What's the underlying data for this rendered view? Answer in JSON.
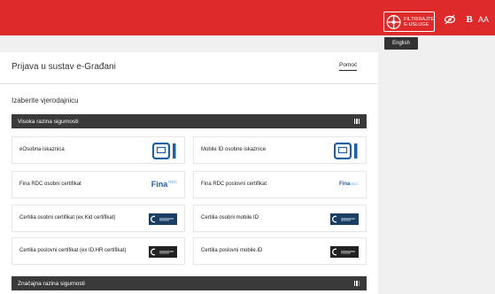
{
  "topbar": {
    "filter_label_1": "FILTRIRAJTE",
    "filter_label_2": "E-USLUGE",
    "icons": [
      "filter-icon",
      "eye-off-icon",
      "bold-text-icon",
      "font-size-icon"
    ],
    "bold_glyph": "B",
    "font_size_glyph": "AA",
    "color": "#df2a2b"
  },
  "language": {
    "label": "English"
  },
  "header": {
    "title": "Prijava u sustav e-Građani",
    "help": "Pomoć"
  },
  "main": {
    "choose_label": "Izaberite vjerodajnicu",
    "sections": [
      {
        "title": "Visoka razina sigurnosti",
        "credentials": [
          {
            "label": "eOsobna iskaznica",
            "logo_icon": "eid-card-icon"
          },
          {
            "label": "Mobile ID osobne iskaznice",
            "logo_icon": "mobile-id-card-icon"
          },
          {
            "label": "Fina RDC osobni certifikat",
            "logo_text": "Fina",
            "logo_sub": "RDC",
            "logo_icon": "fina-logo"
          },
          {
            "label": "Fina RDC poslovni certifikat",
            "logo_text": "Fina",
            "logo_sub": "RDC",
            "logo_icon": "fina-logo"
          },
          {
            "label": "Certilia osobni certifikat (ex Kid certifikat)",
            "logo_icon": "certilia-logo"
          },
          {
            "label": "Certilia osobni mobile.ID",
            "logo_icon": "certilia-logo"
          },
          {
            "label": "Certilia poslovni certifikat (ex ID.HR certifikat)",
            "logo_icon": "certilia-logo"
          },
          {
            "label": "Certilia poslovni mobile.ID",
            "logo_icon": "certilia-logo"
          }
        ]
      },
      {
        "title": "Značajna razina sigurnosti"
      }
    ]
  }
}
